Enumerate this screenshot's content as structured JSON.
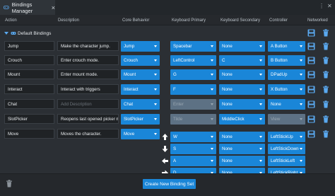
{
  "window": {
    "tab_title": "Bindings Manager",
    "tab_close": "×",
    "menu_glyph": "⋮",
    "close_glyph": "✕"
  },
  "columns": {
    "action": "Action",
    "description": "Description",
    "core_behavior": "Core Behavior",
    "keyboard_primary": "Keyboard Primary",
    "keyboard_secondary": "Keyboard Secondary",
    "controller": "Controller",
    "networked": "Networked"
  },
  "group": {
    "label": "Default Bindings"
  },
  "rows": [
    {
      "action": "Jump",
      "description": "Make the character jump.",
      "core": "Jump",
      "kb1": "Spacebar",
      "kb2": "None",
      "ctrl": "A Button"
    },
    {
      "action": "Crouch",
      "description": "Enter crouch mode.",
      "core": "Crouch",
      "kb1": "LeftControl",
      "kb2": "C",
      "ctrl": "B Button"
    },
    {
      "action": "Mount",
      "description": "Enter mount mode.",
      "core": "Mount",
      "kb1": "G",
      "kb2": "None",
      "ctrl": "DPadUp"
    },
    {
      "action": "Interact",
      "description": "Interact with triggers",
      "core": "Interact",
      "kb1": "F",
      "kb2": "None",
      "ctrl": "X Button"
    },
    {
      "action": "Chat",
      "description": "",
      "description_placeholder": "Add Description",
      "core": "Chat",
      "kb1": "Enter",
      "kb2": "None",
      "ctrl": "None"
    },
    {
      "action": "SlotPicker",
      "description": "Reopens last opened picker me",
      "core": "SlotPicker",
      "kb1": "Tilde",
      "kb2": "MiddleClick",
      "ctrl": "View"
    },
    {
      "action": "Move",
      "description": "Moves the character.",
      "core": "Move"
    }
  ],
  "move_directions": [
    {
      "arrow": "up-arrow-icon",
      "kb1": "W",
      "kb2": "None",
      "ctrl": "LeftStickUp"
    },
    {
      "arrow": "down-arrow-icon",
      "kb1": "S",
      "kb2": "None",
      "ctrl": "LeftStickDown"
    },
    {
      "arrow": "left-arrow-icon",
      "kb1": "A",
      "kb2": "None",
      "ctrl": "LeftStickLeft"
    },
    {
      "arrow": "right-arrow-icon",
      "kb1": "D",
      "kb2": "None",
      "ctrl": "LeftStickRight"
    }
  ],
  "footer": {
    "create_button": "Create New Binding Set"
  },
  "colors": {
    "accent": "#1a86d8",
    "disabled": "#5d7184",
    "background": "#2b2f34"
  }
}
